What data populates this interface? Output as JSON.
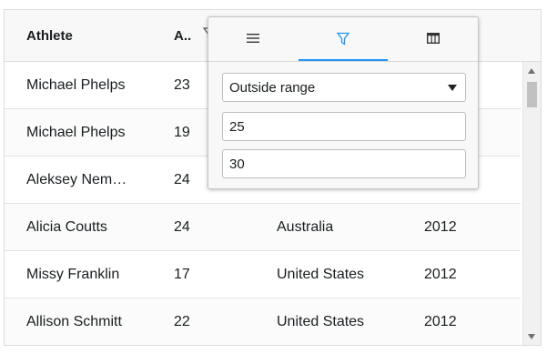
{
  "columns": [
    {
      "label": "Athlete"
    },
    {
      "label": "A.."
    }
  ],
  "rows": [
    {
      "athlete": "Michael Phelps",
      "age": "23",
      "country": "",
      "year": ""
    },
    {
      "athlete": "Michael Phelps",
      "age": "19",
      "country": "",
      "year": ""
    },
    {
      "athlete": "Aleksey Nem…",
      "age": "24",
      "country": "",
      "year": ""
    },
    {
      "athlete": "Alicia Coutts",
      "age": "24",
      "country": "Australia",
      "year": "2012"
    },
    {
      "athlete": "Missy Franklin",
      "age": "17",
      "country": "United States",
      "year": "2012"
    },
    {
      "athlete": "Allison Schmitt",
      "age": "22",
      "country": "United States",
      "year": "2012"
    }
  ],
  "filter_popup": {
    "tabs": [
      {
        "icon": "menu-icon",
        "active": false
      },
      {
        "icon": "filter-icon",
        "active": true
      },
      {
        "icon": "columns-icon",
        "active": false
      }
    ],
    "operator": "Outside range",
    "from": "25",
    "to": "30"
  },
  "colors": {
    "accent": "#2196f3",
    "header_bg": "#f8f8f8",
    "border": "#dcdcdc"
  }
}
